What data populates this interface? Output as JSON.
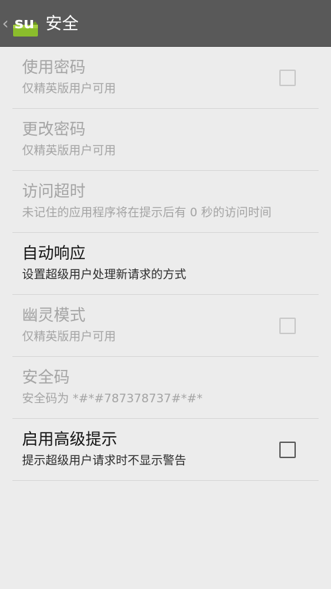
{
  "header": {
    "icon": "superuser-app-icon",
    "title": "安全"
  },
  "settings": [
    {
      "title": "使用密码",
      "summary": "仅精英版用户可用",
      "enabled": false,
      "checkbox": true,
      "checked": false
    },
    {
      "title": "更改密码",
      "summary": "仅精英版用户可用",
      "enabled": false,
      "checkbox": false
    },
    {
      "title": "访问超时",
      "summary": "未记住的应用程序将在提示后有 0 秒的访问时间",
      "enabled": false,
      "checkbox": false
    },
    {
      "title": "自动响应",
      "summary": "设置超级用户处理新请求的方式",
      "enabled": true,
      "checkbox": false
    },
    {
      "title": "幽灵模式",
      "summary": "仅精英版用户可用",
      "enabled": false,
      "checkbox": true,
      "checked": false
    },
    {
      "title": "安全码",
      "summary": "安全码为 *#*#787378737#*#*",
      "enabled": false,
      "checkbox": false
    },
    {
      "title": "启用高级提示",
      "summary": "提示超级用户请求时不显示警告",
      "enabled": true,
      "checkbox": true,
      "checked": false
    }
  ]
}
